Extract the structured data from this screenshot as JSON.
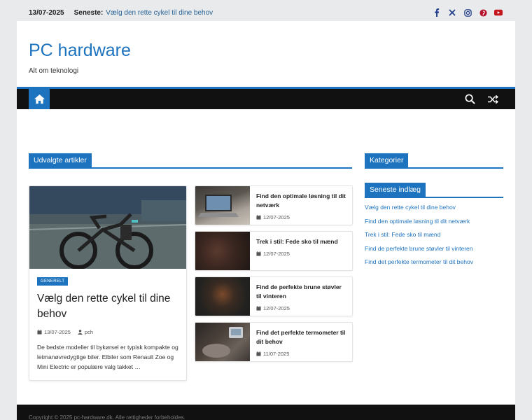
{
  "topbar": {
    "date": "13/07-2025",
    "latest_label": "Seneste:",
    "latest_link": "Vælg den rette cykel til dine behov"
  },
  "social_icons": [
    "facebook-icon",
    "x-icon",
    "instagram-icon",
    "pinterest-icon",
    "youtube-icon"
  ],
  "site": {
    "title": "PC hardware",
    "description": "Alt om teknologi"
  },
  "colors": {
    "accent": "#1e73be",
    "nav_bg": "#111111"
  },
  "main": {
    "section_title": "Udvalgte artikler",
    "featured": {
      "category": "GENERELT",
      "title": "Vælg den rette cykel til dine behov",
      "date": "13/07-2025",
      "author": "pch",
      "excerpt": "De bedste modeller til bykørsel er typisk kompakte og letmanøvredygtige biler. Elbiler som Renault Zoe og Mini Electric er populære valg takket …"
    },
    "articles": [
      {
        "title": "Find den optimale løsning til dit netværk",
        "date": "12/07-2025"
      },
      {
        "title": "Trek i stil: Fede sko til mænd",
        "date": "12/07-2025"
      },
      {
        "title": "Find de perfekte brune støvler til vinteren",
        "date": "12/07-2025"
      },
      {
        "title": "Find det perfekte termometer til dit behov",
        "date": "11/07-2025"
      }
    ]
  },
  "sidebar": {
    "categories_title": "Kategorier",
    "recent_title": "Seneste indlæg",
    "recent_posts": [
      "Vælg den rette cykel til dine behov",
      "Find den optimale løsning til dit netværk",
      "Trek i stil: Fede sko til mænd",
      "Find de perfekte brune støvler til vinteren",
      "Find det perfekte termometer til dit behov"
    ]
  },
  "footer": {
    "text": "Copyright © 2025 pc-hardware.dk. Alle rettigheder forbeholdes."
  }
}
